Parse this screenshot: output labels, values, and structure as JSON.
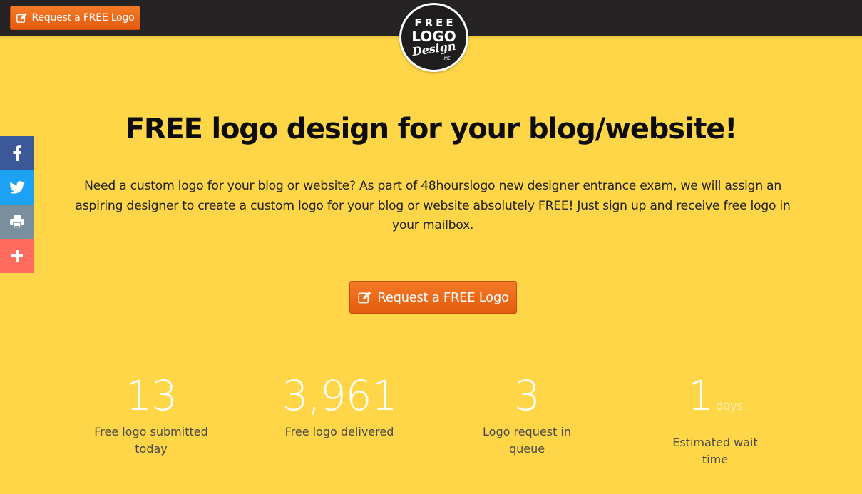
{
  "header": {
    "request_button_label": "Request a FREE Logo",
    "logo": {
      "line1": "FREE",
      "line2": "LOGO",
      "line3": "Design",
      "line4": ".ME"
    }
  },
  "social": {
    "items": [
      "facebook-icon",
      "twitter-icon",
      "print-icon",
      "plus-icon"
    ]
  },
  "hero": {
    "headline": "FREE logo design for your blog/website!",
    "description": "Need a custom logo for your blog or website? As part of 48hourslogo new designer entrance exam, we will assign an aspiring designer to create a custom logo for your blog or website absolutely FREE! Just sign up and receive free logo in your mailbox.",
    "cta_label": "Request a FREE Logo"
  },
  "stats": [
    {
      "value": "13",
      "unit": "",
      "label": "Free logo submitted today"
    },
    {
      "value": "3,961",
      "unit": "",
      "label": "Free logo delivered"
    },
    {
      "value": "3",
      "unit": "",
      "label": "Logo request in queue"
    },
    {
      "value": "1",
      "unit": "days",
      "label": "Estimated wait time"
    }
  ],
  "colors": {
    "background": "#FED647",
    "topbar": "#252324",
    "button": "#EC6A1A",
    "facebook": "#3B5998",
    "twitter": "#1DA1F2",
    "print": "#7A8F9E",
    "more": "#FF6B5F"
  }
}
